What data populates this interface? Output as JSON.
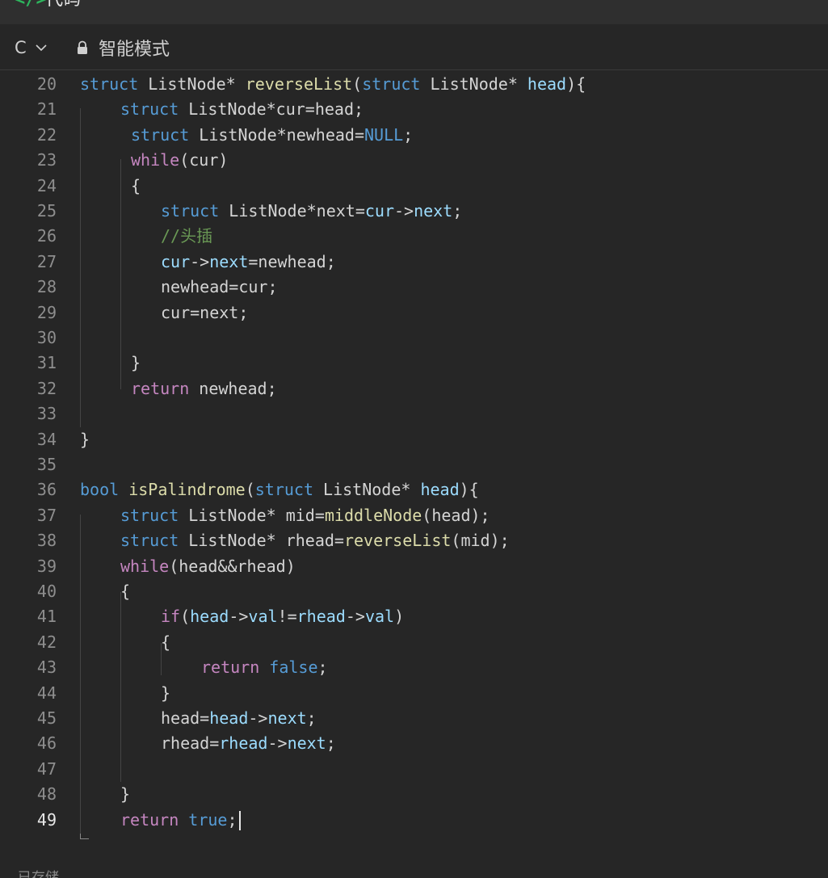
{
  "header": {
    "icon": "code-icon",
    "icon_glyph": "</>",
    "title": "代码"
  },
  "toolbar": {
    "language": "C",
    "mode_icon": "lock-icon",
    "mode_label": "智能模式"
  },
  "editor": {
    "active_line": 49,
    "lines": [
      {
        "n": "20",
        "indent": 0,
        "tokens": [
          [
            "kw",
            "struct"
          ],
          [
            "p",
            " ListNode* "
          ],
          [
            "fn",
            "reverseList"
          ],
          [
            "p",
            "("
          ],
          [
            "kw",
            "struct"
          ],
          [
            "p",
            " ListNode* "
          ],
          [
            "var",
            "head"
          ],
          [
            "p",
            "){"
          ]
        ]
      },
      {
        "n": "21",
        "indent": 1,
        "tokens": [
          [
            "kw",
            "struct"
          ],
          [
            "p",
            " ListNode*cur=head;"
          ]
        ]
      },
      {
        "n": "22",
        "indent": 2,
        "tokens": [
          [
            "kw",
            "struct"
          ],
          [
            "p",
            " ListNode*newhead="
          ],
          [
            "const",
            "NULL"
          ],
          [
            "p",
            ";"
          ]
        ]
      },
      {
        "n": "23",
        "indent": 2,
        "tokens": [
          [
            "ctrl",
            "while"
          ],
          [
            "p",
            "(cur)"
          ]
        ]
      },
      {
        "n": "24",
        "indent": 2,
        "tokens": [
          [
            "p",
            "{"
          ]
        ]
      },
      {
        "n": "25",
        "indent": 3,
        "tokens": [
          [
            "kw",
            "struct"
          ],
          [
            "p",
            " ListNode*next="
          ],
          [
            "var",
            "cur"
          ],
          [
            "p",
            "->"
          ],
          [
            "var",
            "next"
          ],
          [
            "p",
            ";"
          ]
        ]
      },
      {
        "n": "26",
        "indent": 3,
        "tokens": [
          [
            "cm",
            "//头插"
          ]
        ]
      },
      {
        "n": "27",
        "indent": 3,
        "tokens": [
          [
            "var",
            "cur"
          ],
          [
            "p",
            "->"
          ],
          [
            "var",
            "next"
          ],
          [
            "p",
            "=newhead;"
          ]
        ]
      },
      {
        "n": "28",
        "indent": 3,
        "tokens": [
          [
            "p",
            "newhead=cur;"
          ]
        ]
      },
      {
        "n": "29",
        "indent": 3,
        "tokens": [
          [
            "p",
            "cur=next;"
          ]
        ]
      },
      {
        "n": "30",
        "indent": 3,
        "tokens": []
      },
      {
        "n": "31",
        "indent": 2,
        "tokens": [
          [
            "p",
            "}"
          ]
        ]
      },
      {
        "n": "32",
        "indent": 2,
        "tokens": [
          [
            "ctrl",
            "return"
          ],
          [
            "p",
            " newhead;"
          ]
        ]
      },
      {
        "n": "33",
        "indent": 0,
        "tokens": []
      },
      {
        "n": "34",
        "indent": 0,
        "tokens": [
          [
            "p",
            "}"
          ]
        ]
      },
      {
        "n": "35",
        "indent": 0,
        "tokens": []
      },
      {
        "n": "36",
        "indent": 0,
        "tokens": [
          [
            "kw",
            "bool"
          ],
          [
            "p",
            " "
          ],
          [
            "fn",
            "isPalindrome"
          ],
          [
            "p",
            "("
          ],
          [
            "kw",
            "struct"
          ],
          [
            "p",
            " ListNode* "
          ],
          [
            "var",
            "head"
          ],
          [
            "p",
            "){"
          ]
        ]
      },
      {
        "n": "37",
        "indent": 1,
        "tokens": [
          [
            "kw",
            "struct"
          ],
          [
            "p",
            " ListNode* mid="
          ],
          [
            "fn",
            "middleNode"
          ],
          [
            "p",
            "(head);"
          ]
        ]
      },
      {
        "n": "38",
        "indent": 1,
        "tokens": [
          [
            "kw",
            "struct"
          ],
          [
            "p",
            " ListNode* rhead="
          ],
          [
            "fn",
            "reverseList"
          ],
          [
            "p",
            "(mid);"
          ]
        ]
      },
      {
        "n": "39",
        "indent": 1,
        "tokens": [
          [
            "ctrl",
            "while"
          ],
          [
            "p",
            "(head&&rhead)"
          ]
        ]
      },
      {
        "n": "40",
        "indent": 1,
        "tokens": [
          [
            "p",
            "{"
          ]
        ]
      },
      {
        "n": "41",
        "indent": 3,
        "tokens": [
          [
            "ctrl",
            "if"
          ],
          [
            "p",
            "("
          ],
          [
            "var",
            "head"
          ],
          [
            "p",
            "->"
          ],
          [
            "var",
            "val"
          ],
          [
            "p",
            "!="
          ],
          [
            "var",
            "rhead"
          ],
          [
            "p",
            "->"
          ],
          [
            "var",
            "val"
          ],
          [
            "p",
            ")"
          ]
        ]
      },
      {
        "n": "42",
        "indent": 3,
        "tokens": [
          [
            "p",
            "{"
          ]
        ]
      },
      {
        "n": "43",
        "indent": 4,
        "tokens": [
          [
            "ctrl",
            "return"
          ],
          [
            "p",
            " "
          ],
          [
            "const",
            "false"
          ],
          [
            "p",
            ";"
          ]
        ]
      },
      {
        "n": "44",
        "indent": 3,
        "tokens": [
          [
            "p",
            "}"
          ]
        ]
      },
      {
        "n": "45",
        "indent": 3,
        "tokens": [
          [
            "p",
            "head="
          ],
          [
            "var",
            "head"
          ],
          [
            "p",
            "->"
          ],
          [
            "var",
            "next"
          ],
          [
            "p",
            ";"
          ]
        ]
      },
      {
        "n": "46",
        "indent": 3,
        "tokens": [
          [
            "p",
            "rhead="
          ],
          [
            "var",
            "rhead"
          ],
          [
            "p",
            "->"
          ],
          [
            "var",
            "next"
          ],
          [
            "p",
            ";"
          ]
        ]
      },
      {
        "n": "47",
        "indent": 3,
        "tokens": []
      },
      {
        "n": "48",
        "indent": 1,
        "tokens": [
          [
            "p",
            "}"
          ]
        ]
      },
      {
        "n": "49",
        "indent": 1,
        "tokens": [
          [
            "ctrl",
            "return"
          ],
          [
            "p",
            " "
          ],
          [
            "const",
            "true"
          ],
          [
            "p",
            ";"
          ]
        ]
      }
    ]
  },
  "status": {
    "text": "已存储"
  },
  "colors": {
    "kw": "#569cd6",
    "ctrl": "#c586c0",
    "fn": "#dcdcaa",
    "var": "#9cdcfe",
    "const": "#569cd6",
    "cm": "#6a9955",
    "p": "#d4d4d4"
  }
}
